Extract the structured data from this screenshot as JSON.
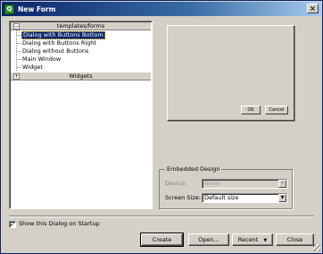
{
  "window": {
    "title": "New Form",
    "app_icon_glyph": "Q"
  },
  "tree": {
    "categories": [
      {
        "label": "templates/forms",
        "toggle": "−",
        "expanded": true
      },
      {
        "label": "Widgets",
        "toggle": "+",
        "expanded": false
      }
    ],
    "items": [
      {
        "label": "Dialog with Buttons Bottom",
        "selected": true
      },
      {
        "label": "Dialog with Buttons Right",
        "selected": false
      },
      {
        "label": "Dialog without Buttons",
        "selected": false
      },
      {
        "label": "Main Window",
        "selected": false
      },
      {
        "label": "Widget",
        "selected": false
      }
    ]
  },
  "preview": {
    "ok_label": "OK",
    "cancel_label": "Cancel"
  },
  "embedded": {
    "title": "Embedded Design",
    "device_label": "Device:",
    "device_value": "None",
    "screen_size_label": "Screen Size:",
    "screen_size_value": "Default size"
  },
  "startup": {
    "label": "Show this Dialog on Startup",
    "checked": true
  },
  "buttons": {
    "create": "Create",
    "open": "Open...",
    "recent": "Recent",
    "close": "Close"
  }
}
